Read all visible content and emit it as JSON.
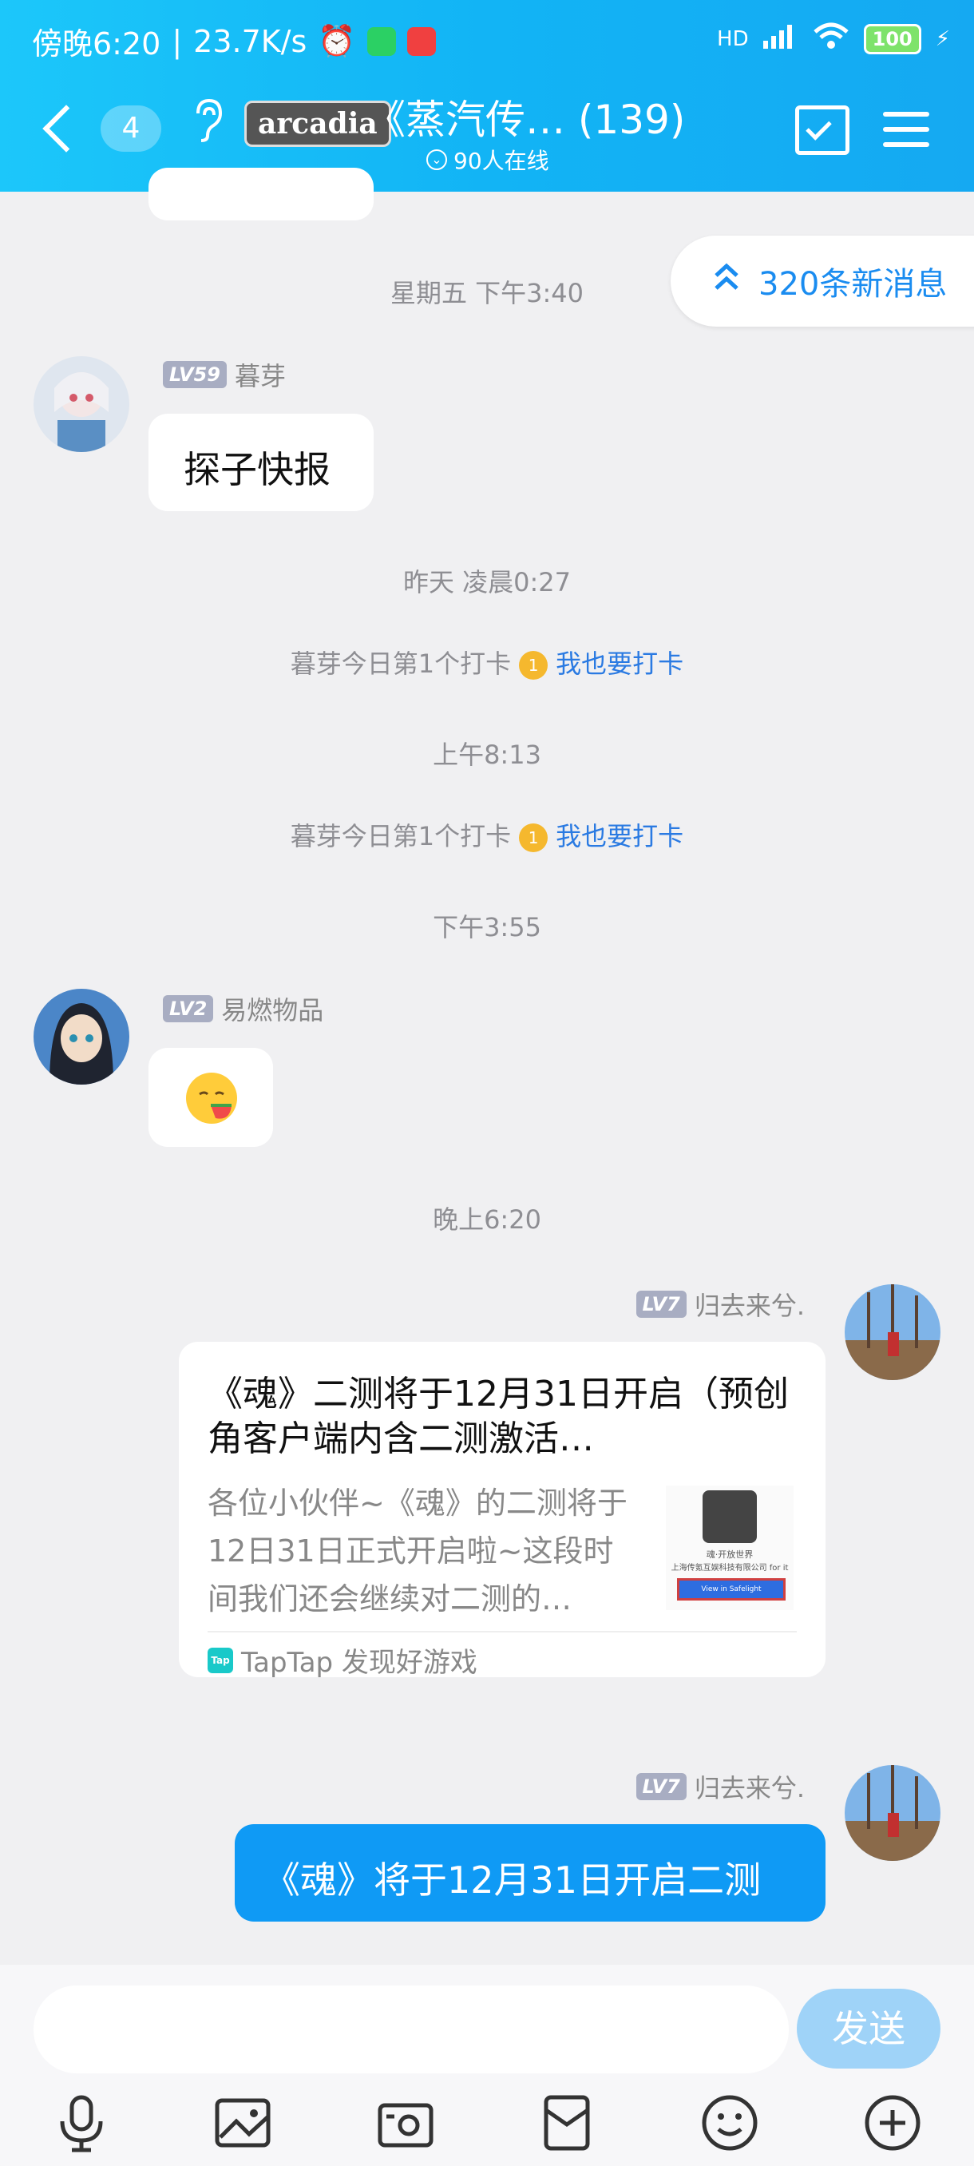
{
  "status_bar": {
    "time": "傍晚6:20",
    "net_speed": "23.7K/s",
    "signal": "HD",
    "battery": "100"
  },
  "header": {
    "unread_count": "4",
    "group_logo": "arcadia",
    "title": "《蒸汽传…  (139)",
    "online": "90人在线"
  },
  "new_messages": "320条新消息",
  "chat": {
    "ts1": "星期五 下午3:40",
    "msg1": {
      "level": "LV59",
      "name": "暮芽",
      "text": "探子快报"
    },
    "ts2": "昨天 凌晨0:27",
    "sys1": {
      "text": "暮芽今日第1个打卡",
      "link": "我也要打卡"
    },
    "ts3": "上午8:13",
    "sys2": {
      "text": "暮芽今日第1个打卡",
      "link": "我也要打卡"
    },
    "ts4": "下午3:55",
    "msg2": {
      "level": "LV2",
      "name": "易燃物品"
    },
    "ts5": "晚上6:20",
    "msg3": {
      "level": "LV7",
      "name": "归去来兮.",
      "card_title": "《魂》二测将于12月31日开启（预创角客户端内含二测激活…",
      "card_desc": "各位小伙伴~《魂》的二测将于12日31日正式开启啦~这段时间我们还会继续对二测的…",
      "thumb_text1": "魂·开放世界",
      "thumb_text2": "上海传氪互娱科技有限公司 for it",
      "thumb_button": "View in Safelight",
      "source_icon": "Tap",
      "source": "TapTap 发现好游戏"
    },
    "msg4": {
      "level": "LV7",
      "name": "归去来兮.",
      "text": "《魂》将于12月31日开启二测"
    }
  },
  "composer": {
    "placeholder": "",
    "send_label": "发送"
  }
}
